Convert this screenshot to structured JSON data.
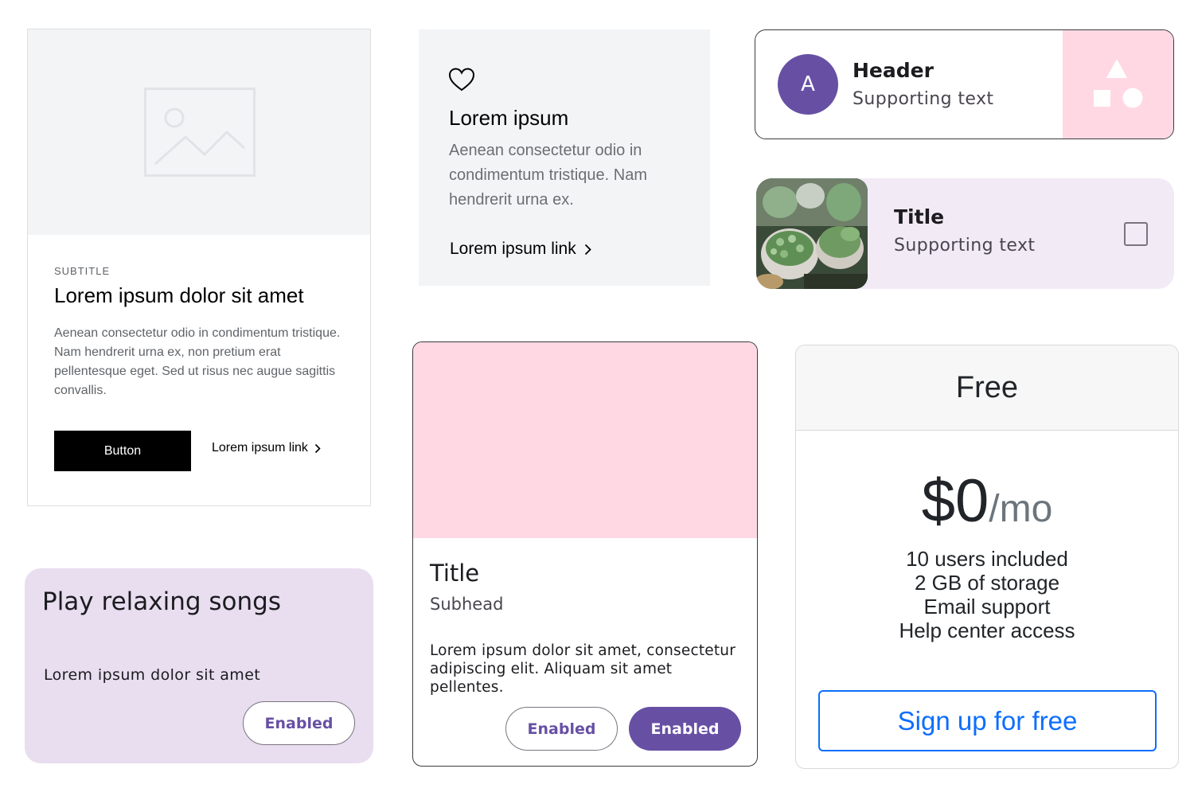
{
  "image_card": {
    "subtitle": "SUBTITLE",
    "title": "Lorem ipsum dolor sit amet",
    "body": "Aenean consectetur odio in condimentum tristique. Nam hendrerit urna ex, non pretium erat pellentesque eget. Sed ut risus nec augue sagittis convallis.",
    "button_label": "Button",
    "link_label": "Lorem ipsum link"
  },
  "gray_card": {
    "title": "Lorem ipsum",
    "body": "Aenean consectetur odio in condimentum tristique. Nam hendrerit urna ex.",
    "link_label": "Lorem ipsum link"
  },
  "header_card": {
    "avatar_letter": "A",
    "header": "Header",
    "supporting_text": "Supporting text",
    "accent_color": "#6750a4",
    "media_color": "#ffd8e4"
  },
  "list_card": {
    "title": "Title",
    "supporting_text": "Supporting text",
    "checkbox_checked": false,
    "background": "#f2ebf6"
  },
  "play_card": {
    "title": "Play relaxing songs",
    "body": "Lorem ipsum dolor sit amet",
    "button_label": "Enabled",
    "background": "#e8def0"
  },
  "media_card": {
    "title": "Title",
    "subhead": "Subhead",
    "body": "Lorem ipsum dolor sit amet, consectetur adipiscing elit. Aliquam sit amet pellentes.",
    "outline_button_label": "Enabled",
    "filled_button_label": "Enabled",
    "media_color": "#ffd8e4"
  },
  "pricing_card": {
    "plan": "Free",
    "price": "$0",
    "period": "/mo",
    "features": [
      "10 users included",
      "2 GB of storage",
      "Email support",
      "Help center access"
    ],
    "button_label": "Sign up for free",
    "accent_color": "#0d6efd"
  }
}
